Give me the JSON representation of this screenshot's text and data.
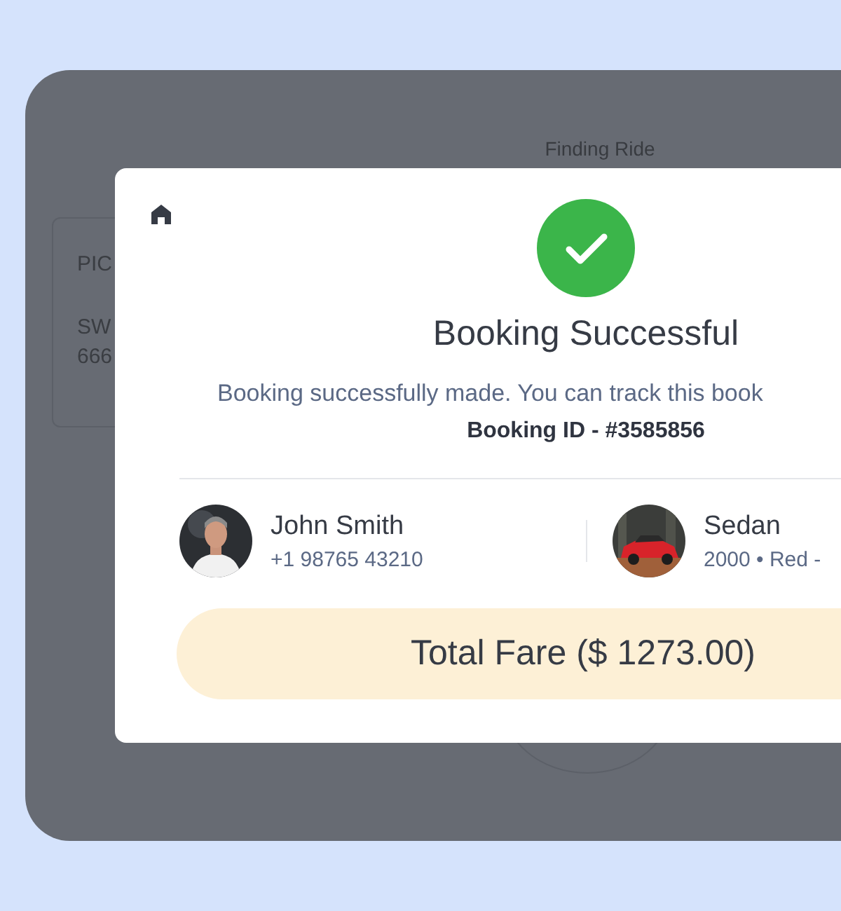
{
  "background": {
    "title": "Finding Ride",
    "card_lines": [
      "PIC",
      "SW",
      "666"
    ]
  },
  "modal": {
    "title": "Booking Successful",
    "message": "Booking successfully made. You can track this book",
    "booking_id": "Booking ID - #3585856",
    "driver": {
      "name": "John Smith",
      "phone": "+1 98765 43210"
    },
    "vehicle": {
      "name": "Sedan",
      "details": "2000 • Red -"
    },
    "total": "Total Fare ($ 1273.00)"
  }
}
